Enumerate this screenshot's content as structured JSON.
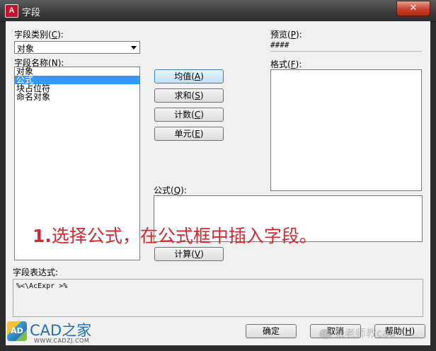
{
  "window": {
    "title": "字段",
    "logo_letter": "A",
    "close_glyph": "✕"
  },
  "field_category": {
    "label": "字段类别",
    "hotkey": "C",
    "value": "对象"
  },
  "field_names": {
    "label": "字段名称",
    "hotkey": "N",
    "items": [
      "对象",
      "公式",
      "块占位符",
      "命名对象"
    ],
    "selected_index": 1
  },
  "buttons": {
    "average": {
      "label": "均值",
      "hotkey": "A"
    },
    "sum": {
      "label": "求和",
      "hotkey": "S"
    },
    "count": {
      "label": "计数",
      "hotkey": "C"
    },
    "cell": {
      "label": "单元",
      "hotkey": "E"
    },
    "evaluate": {
      "label": "计算",
      "hotkey": "V"
    },
    "ok": {
      "label": "确定"
    },
    "cancel": {
      "label": "取消"
    },
    "help": {
      "label": "帮助",
      "hotkey": "H"
    }
  },
  "preview": {
    "label": "预览",
    "hotkey": "P",
    "value": "####"
  },
  "format": {
    "label": "格式",
    "hotkey": "F"
  },
  "formula": {
    "label": "公式",
    "hotkey": "Q"
  },
  "annotation": {
    "number": "1.",
    "text": "选择公式，在公式框中插入字段。",
    "color": "#d9262b"
  },
  "expression": {
    "label": "字段表达式:",
    "value": "%<\\AcExpr >%"
  },
  "branding": {
    "name": "CAD之家",
    "url": "WWW.CADZJ.COM",
    "cube_letters": "AD"
  },
  "watermark": {
    "text": "张老师教cad"
  },
  "colors": {
    "selection": "#3399ff",
    "titlebar": "#3a3a3a",
    "close": "#c9412a"
  }
}
